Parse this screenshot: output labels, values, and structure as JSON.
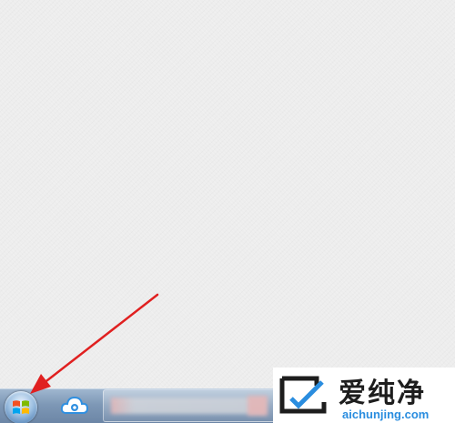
{
  "screen": {
    "os": "Windows 7",
    "taskbar": {
      "start_button": {
        "icon": "windows-logo-icon",
        "label": "Start"
      },
      "pinned_apps": [
        {
          "icon": "cloud-app-icon"
        }
      ],
      "open_window": {
        "title": ""
      }
    }
  },
  "annotation": {
    "type": "arrow",
    "color": "#e02020",
    "points_to": "start-button"
  },
  "watermark": {
    "chinese": "爱纯净",
    "domain": "aichunjing.com"
  },
  "colors": {
    "desktop": "#ededed",
    "taskbar": "#7e98b6",
    "arrow": "#e02020",
    "watermark_text": "#2a8ddf"
  }
}
